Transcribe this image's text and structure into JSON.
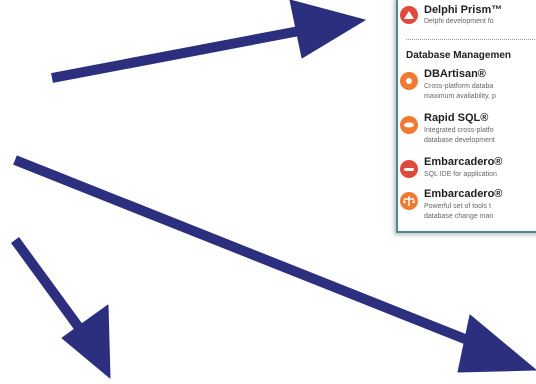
{
  "menu": {
    "top_item": {
      "title": "Delphi Prism™",
      "desc": "Delphi development fo",
      "icon": "delphi-prism-icon"
    },
    "section_heading": "Database Managemen",
    "items": [
      {
        "title": "DBArtisan®",
        "desc1": "Cross-platform databa",
        "desc2": "maximum availability, p",
        "icon": "dbartisan-icon"
      },
      {
        "title": "Rapid SQL®",
        "desc1": "Integrated cross-platfo",
        "desc2": "database development",
        "icon": "rapid-sql-icon"
      },
      {
        "title": "Embarcadero®",
        "desc1": "SQL IDE for application",
        "desc2": "",
        "icon": "embarcadero-sql-icon"
      },
      {
        "title": "Embarcadero®",
        "desc1": "Powerful set of tools t",
        "desc2": "database change man",
        "icon": "embarcadero-change-icon"
      }
    ]
  },
  "colors": {
    "arrow": "#2b2f7e",
    "panel_border": "#4a8c8c",
    "icon_red": "#e04a3c",
    "icon_orange": "#f07a32"
  }
}
